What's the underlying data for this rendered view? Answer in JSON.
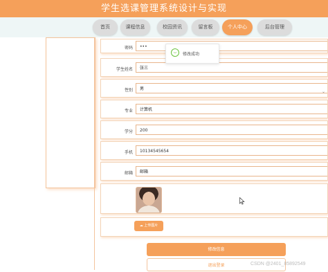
{
  "app": {
    "title": "学生选课管理系统设计与实现"
  },
  "nav": {
    "items": [
      {
        "label": "首页"
      },
      {
        "label": "课程信息"
      },
      {
        "label": "校园资讯"
      },
      {
        "label": "留言板"
      },
      {
        "label": "个人中心"
      },
      {
        "label": "后台管理"
      }
    ],
    "active_index": 4
  },
  "form": {
    "password": {
      "label": "密码",
      "value": "•••"
    },
    "name": {
      "label": "学生姓名",
      "value": "张三"
    },
    "gender": {
      "label": "性别",
      "value": "男"
    },
    "major": {
      "label": "专业",
      "value": "计算机"
    },
    "credits": {
      "label": "学分",
      "value": "200"
    },
    "phone": {
      "label": "手机",
      "value": "10134545654"
    },
    "email": {
      "label": "邮箱",
      "value": "邮箱"
    },
    "avatar": {
      "label": ""
    },
    "upload": {
      "label": "上传图片"
    }
  },
  "actions": {
    "save_label": "修改信息",
    "logout_label": "退出登录"
  },
  "toast": {
    "message": "修改成功",
    "icon": "smile-icon"
  },
  "watermark": "CSDN @2401_85892549",
  "colors": {
    "accent": "#f5a05a",
    "success": "#67c23a",
    "nav_bg": "#eef6f6"
  }
}
